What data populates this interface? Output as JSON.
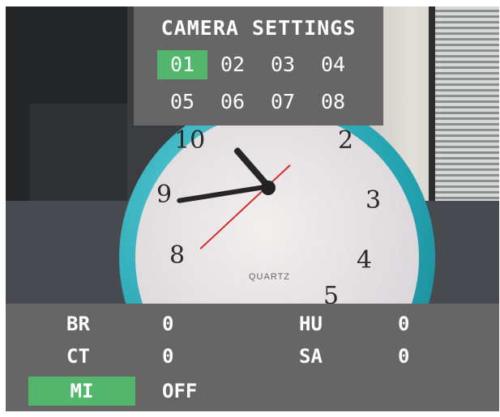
{
  "osd": {
    "title": "CAMERA SETTINGS",
    "cameras": [
      "01",
      "02",
      "03",
      "04",
      "05",
      "06",
      "07",
      "08"
    ],
    "selected_camera": "01",
    "selection_color": "#52b66c",
    "panel_color": "#666666"
  },
  "params": {
    "br": {
      "label": "BR",
      "value": "0"
    },
    "ct": {
      "label": "CT",
      "value": "0"
    },
    "mi": {
      "label": "MI",
      "value": "OFF"
    },
    "hu": {
      "label": "HU",
      "value": "0"
    },
    "sa": {
      "label": "SA",
      "value": "0"
    },
    "selected": "MI"
  },
  "scene": {
    "clock_numerals": [
      "10",
      "2",
      "9",
      "3",
      "8",
      "4",
      "5"
    ],
    "clock_brand": "QUARTZ"
  }
}
